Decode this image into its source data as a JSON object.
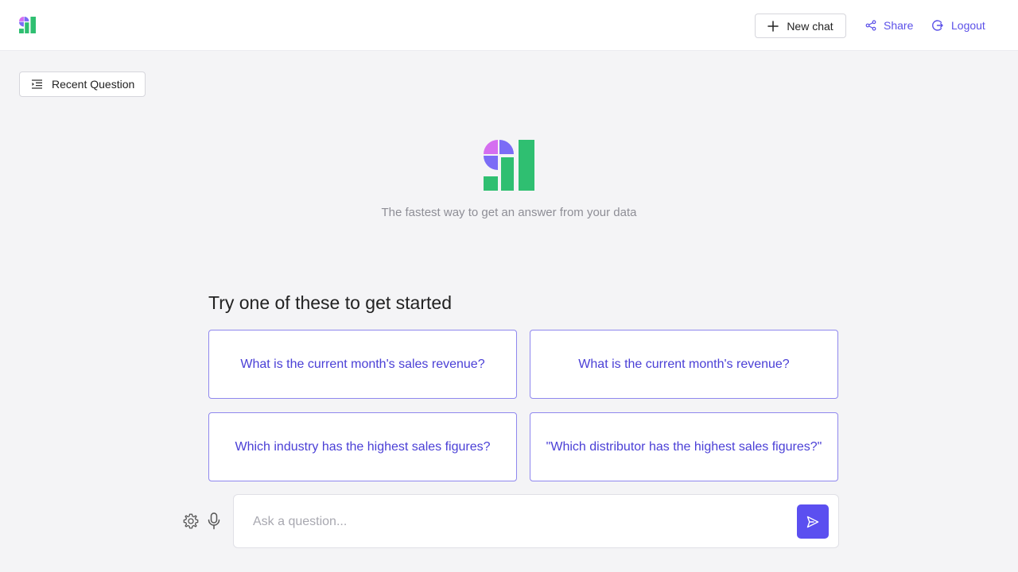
{
  "header": {
    "new_chat_label": "New chat",
    "share_label": "Share",
    "logout_label": "Logout"
  },
  "toolbar": {
    "recent_question_label": "Recent Question"
  },
  "hero": {
    "tagline": "The fastest way to get an answer from your data"
  },
  "suggestions": {
    "title": "Try one of these to get started",
    "items": [
      "What is the current month's sales revenue?",
      "What is the current month's revenue?",
      "Which industry has the highest sales figures?",
      "\"Which distributor has the highest sales figures?\""
    ]
  },
  "composer": {
    "placeholder": "Ask a question...",
    "value": ""
  },
  "icons": {
    "logo": "app-logo-icon",
    "new_chat": "plus-icon",
    "share": "share-icon",
    "logout": "logout-icon",
    "recent": "list-indent-icon",
    "settings": "gear-icon",
    "mic": "microphone-icon",
    "send": "send-icon"
  },
  "colors": {
    "accent": "#5b4ff0",
    "link": "#5b50e8",
    "suggestion_text": "#4a3fd6",
    "suggestion_border": "#8f87ee",
    "logo_pink": "#d56ef0",
    "logo_purple": "#7b6cf6",
    "logo_green": "#2fbf71",
    "background": "#f4f4f6"
  }
}
